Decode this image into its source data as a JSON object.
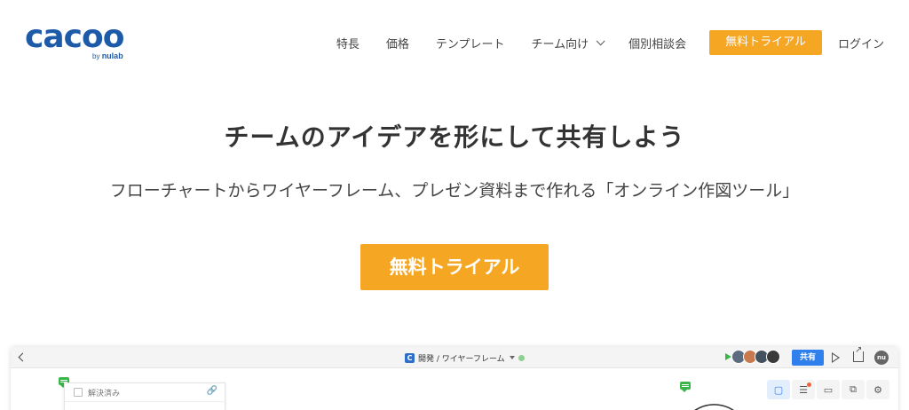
{
  "logo": {
    "word": "cacoo",
    "by_prefix": "by",
    "by_brand": "nulab"
  },
  "nav": {
    "items": [
      "特長",
      "価格",
      "テンプレート",
      "チーム向け",
      "個別相談会"
    ],
    "cta_label": "無料トライアル",
    "login_label": "ログイン"
  },
  "hero": {
    "title": "チームのアイデアを形にして共有しよう",
    "subtitle": "フローチャートからワイヤーフレーム、プレゼン資料まで作れる「オンライン作図ツール」",
    "cta_label": "無料トライアル"
  },
  "preview": {
    "crumb_logo": "C",
    "crumb_text": "開発 / ワイヤーフレーム",
    "share_label": "共有",
    "user_initials": "nu",
    "comment_resolved_label": "解決済み",
    "avatars": [
      "#5b6b80",
      "#c8794e",
      "#44515f",
      "#3a3a3a"
    ]
  },
  "colors": {
    "accent": "#f5a623",
    "brand": "#1d5ba9",
    "share": "#2f80ed"
  }
}
